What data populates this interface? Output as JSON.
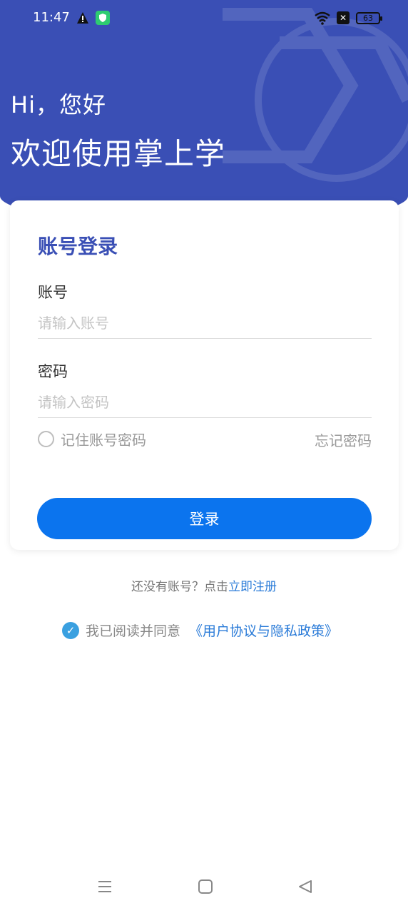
{
  "status": {
    "time": "11:47",
    "battery": "63"
  },
  "header": {
    "greeting": "Hi，您好",
    "welcome": "欢迎使用掌上学"
  },
  "login": {
    "title": "账号登录",
    "account_label": "账号",
    "account_placeholder": "请输入账号",
    "account_value": "",
    "password_label": "密码",
    "password_placeholder": "请输入密码",
    "password_value": "",
    "remember_label": "记住账号密码",
    "forgot_label": "忘记密码",
    "submit_label": "登录"
  },
  "register": {
    "prefix": "还没有账号？点击",
    "link": "立即注册"
  },
  "agreement": {
    "text": "我已阅读并同意",
    "link": "《用户协议与隐私政策》"
  },
  "colors": {
    "header_blue": "#3a4fb5",
    "button_blue": "#0b74ee",
    "link_blue": "#2a7bd8",
    "check_blue": "#3aa0e0"
  },
  "icons": {
    "nav_menu": "menu-icon",
    "nav_home": "home-icon",
    "nav_back": "back-icon"
  }
}
